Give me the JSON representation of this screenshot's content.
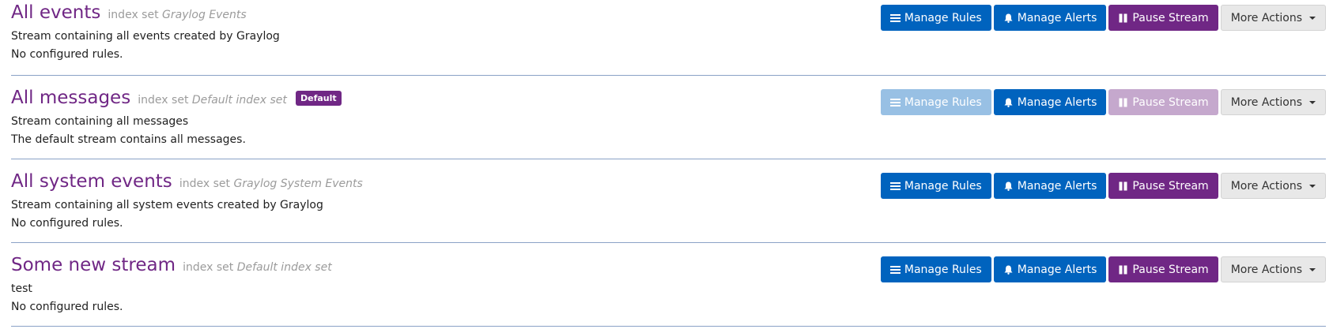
{
  "labels": {
    "index_set_prefix": "index set",
    "manage_rules": "Manage Rules",
    "manage_alerts": "Manage Alerts",
    "pause_stream": "Pause Stream",
    "more_actions": "More Actions"
  },
  "colors": {
    "title": "#702785",
    "primary_button": "#0063be",
    "pause_button": "#702785",
    "divider": "#8aa2c6"
  },
  "icons": {
    "manage_rules": "list-icon",
    "manage_alerts": "bell-icon",
    "pause_stream": "pause-icon",
    "more_actions": "caret-down-icon"
  },
  "streams": [
    {
      "title": "All events",
      "index_set": "Graylog Events",
      "badge": "",
      "description": "Stream containing all events created by Graylog",
      "rules_summary": "No configured rules.",
      "buttons_disabled": false
    },
    {
      "title": "All messages",
      "index_set": "Default index set",
      "badge": "Default",
      "description": "Stream containing all messages",
      "rules_summary": "The default stream contains all messages.",
      "buttons_disabled": true
    },
    {
      "title": "All system events",
      "index_set": "Graylog System Events",
      "badge": "",
      "description": "Stream containing all system events created by Graylog",
      "rules_summary": "No configured rules.",
      "buttons_disabled": false
    },
    {
      "title": "Some new stream",
      "index_set": "Default index set",
      "badge": "",
      "description": "test",
      "rules_summary": "No configured rules.",
      "buttons_disabled": false
    }
  ]
}
